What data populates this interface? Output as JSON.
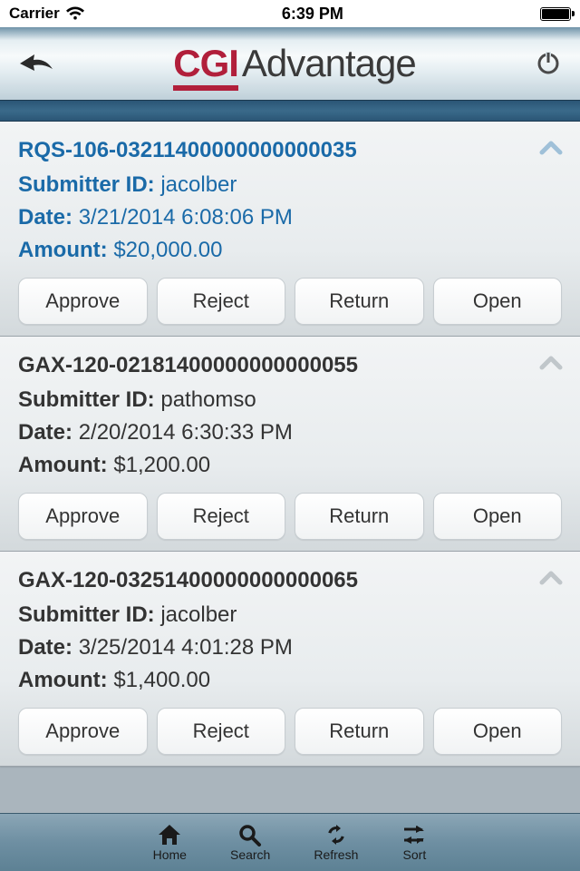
{
  "status": {
    "carrier": "Carrier",
    "time": "6:39 PM"
  },
  "header": {
    "brand1": "CGI",
    "brand2": "Advantage"
  },
  "labels": {
    "submitter": "Submitter ID:",
    "date": "Date:",
    "amount": "Amount:"
  },
  "buttons": {
    "approve": "Approve",
    "reject": "Reject",
    "ret": "Return",
    "open": "Open"
  },
  "cards": [
    {
      "id": "RQS-106-03211400000000000035",
      "submitter": "jacolber",
      "date": "3/21/2014 6:08:06 PM",
      "amount": "$20,000.00",
      "selected": true
    },
    {
      "id": "GAX-120-02181400000000000055",
      "submitter": "pathomso",
      "date": "2/20/2014 6:30:33 PM",
      "amount": "$1,200.00",
      "selected": false
    },
    {
      "id": "GAX-120-03251400000000000065",
      "submitter": "jacolber",
      "date": "3/25/2014 4:01:28 PM",
      "amount": "$1,400.00",
      "selected": false
    }
  ],
  "toolbar": {
    "home": "Home",
    "search": "Search",
    "refresh": "Refresh",
    "sort": "Sort"
  }
}
